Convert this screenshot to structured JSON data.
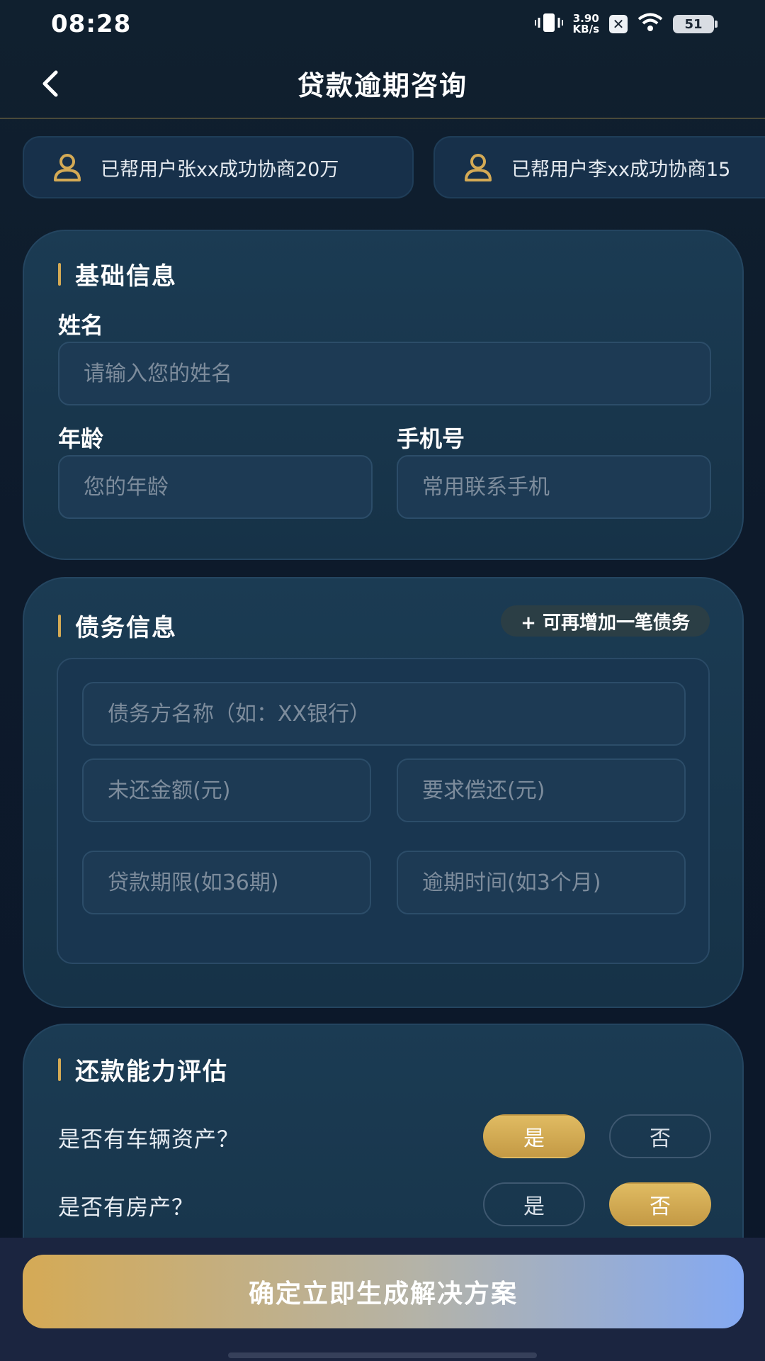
{
  "status_bar": {
    "time": "08:28",
    "net_speed_value": "3.90",
    "net_speed_unit": "KB/s",
    "battery": "51",
    "icons": [
      "vibrate-icon",
      "x-notification-icon",
      "wifi-icon",
      "battery-icon"
    ]
  },
  "header": {
    "title": "贷款逾期咨询",
    "back_icon": "chevron-left-icon"
  },
  "ticker": {
    "items": [
      {
        "text": "已帮用户张xx成功协商20万",
        "icon": "user-icon"
      },
      {
        "text": "已帮用户李xx成功协商15",
        "icon": "user-icon"
      }
    ]
  },
  "basic_info": {
    "title": "基础信息",
    "name_label": "姓名",
    "name_placeholder": "请输入您的姓名",
    "age_label": "年龄",
    "age_placeholder": "您的年龄",
    "phone_label": "手机号",
    "phone_placeholder": "常用联系手机"
  },
  "debt_info": {
    "title": "债务信息",
    "add_button": "+ 可再增加一笔债务",
    "creditor_placeholder": "债务方名称（如：XX银行）",
    "unpaid_placeholder": "未还金额(元)",
    "required_placeholder": "要求偿还(元)",
    "term_placeholder": "贷款期限(如36期)",
    "overdue_placeholder": "逾期时间(如3个月)"
  },
  "ability": {
    "title": "还款能力评估",
    "questions": [
      {
        "text": "是否有车辆资产？",
        "yes": "是",
        "no": "否",
        "selected": "yes"
      },
      {
        "text": "是否有房产？",
        "yes": "是",
        "no": "否",
        "selected": "no"
      }
    ]
  },
  "submit": {
    "label": "确定立即生成解决方案"
  },
  "colors": {
    "accent_gold": "#d4aa55",
    "background": "#0e1a2c",
    "card": "#1b3b53"
  }
}
